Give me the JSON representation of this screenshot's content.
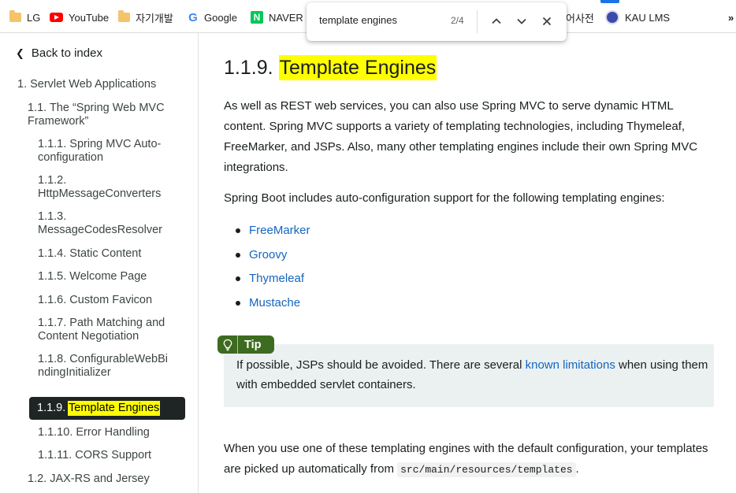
{
  "bookmarks": [
    {
      "label": "LG",
      "icon": "folder-icon"
    },
    {
      "label": "YouTube",
      "icon": "youtube-icon"
    },
    {
      "label": "자기개발",
      "icon": "folder-icon"
    },
    {
      "label": "Google",
      "icon": "google-icon"
    },
    {
      "label": "NAVER",
      "icon": "naver-icon"
    },
    {
      "label": "어사전",
      "icon": ""
    },
    {
      "label": "KAU LMS",
      "icon": "kau-icon"
    },
    {
      "label": "»",
      "icon": "overflow-chevron-icon"
    }
  ],
  "find": {
    "query": "template engines",
    "count": "2/4"
  },
  "sidebar": {
    "back": "Back to index",
    "items": [
      {
        "label": "1. Servlet Web Applications",
        "level": 1
      },
      {
        "label": "1.1. The “Spring Web MVC Framework”",
        "level": 2
      },
      {
        "label": "1.1.1. Spring MVC Auto-configuration",
        "level": 3
      },
      {
        "label": "1.1.2. HttpMessageConverters",
        "level": 3
      },
      {
        "label": "1.1.3. MessageCodesResolver",
        "level": 3
      },
      {
        "label": "1.1.4. Static Content",
        "level": 3
      },
      {
        "label": "1.1.5. Welcome Page",
        "level": 3
      },
      {
        "label": "1.1.6. Custom Favicon",
        "level": 3
      },
      {
        "label": "1.1.7. Path Matching and Content Negotiation",
        "level": 3
      },
      {
        "label": "1.1.8. ConfigurableWebBindingInitializer",
        "level": 3
      },
      {
        "label": "1.1.10. Error Handling",
        "level": 3
      },
      {
        "label": "1.1.11. CORS Support",
        "level": 3
      },
      {
        "label": "1.2. JAX-RS and Jersey",
        "level": 2
      }
    ],
    "active_number": "1.1.9.",
    "active_label": "Template Engines"
  },
  "main": {
    "heading_number": "1.1.9.",
    "heading_title": "Template Engines",
    "para1": "As well as REST web services, you can also use Spring MVC to serve dynamic HTML content. Spring MVC supports a variety of templating technologies, including Thymeleaf, FreeMarker, and JSPs. Also, many other templating engines include their own Spring MVC integrations.",
    "para2": "Spring Boot includes auto-configuration support for the following templating engines:",
    "engines": [
      "FreeMarker",
      "Groovy",
      "Thymeleaf",
      "Mustache"
    ],
    "tip": {
      "label": "Tip",
      "text_before": "If possible, JSPs should be avoided. There are several ",
      "link": "known limitations",
      "text_after": " when using them with embedded servlet containers."
    },
    "para3_before": "When you use one of these templating engines with the default configuration, your templates are picked up automatically from ",
    "para3_code": "src/main/resources/templates",
    "para3_after": "."
  },
  "colors": {
    "highlight": "#ffff00",
    "link": "#1565c0",
    "tip_label_bg": "#3d6b1f",
    "tip_box_bg": "#ebf1f1",
    "active_toc_bg": "#1f2424"
  }
}
